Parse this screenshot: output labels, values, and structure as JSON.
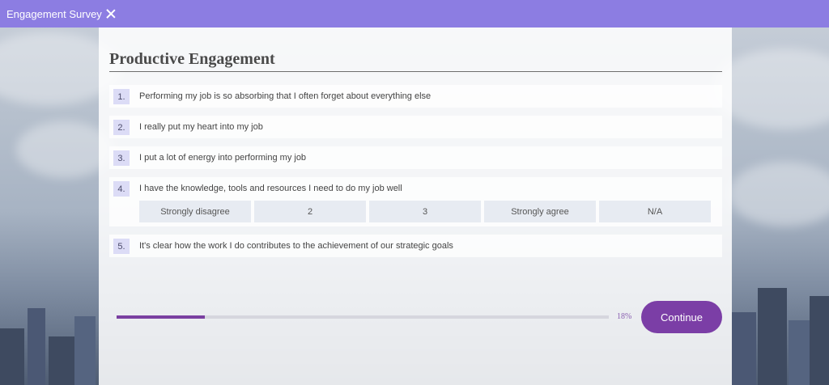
{
  "app": {
    "title": "Engagement Survey"
  },
  "colors": {
    "topbar": "#8c7de2",
    "accent": "#7b3ea6",
    "number_badge": "#dcdcf6"
  },
  "survey": {
    "section_title": "Productive Engagement",
    "questions": [
      {
        "number": "1.",
        "text": "Performing my job is so absorbing that I often forget about everything else"
      },
      {
        "number": "2.",
        "text": "I really put my heart into my job"
      },
      {
        "number": "3.",
        "text": "I put a lot of energy into performing my job"
      },
      {
        "number": "4.",
        "text": "I have the knowledge, tools and resources I need to do my job well",
        "options": [
          "Strongly disagree",
          "2",
          "3",
          "Strongly agree",
          "N/A"
        ]
      },
      {
        "number": "5.",
        "text": "It's clear how the work I do contributes to the achievement of our strategic goals"
      }
    ]
  },
  "progress": {
    "percent": 18,
    "label": "18%"
  },
  "footer": {
    "continue_label": "Continue"
  }
}
